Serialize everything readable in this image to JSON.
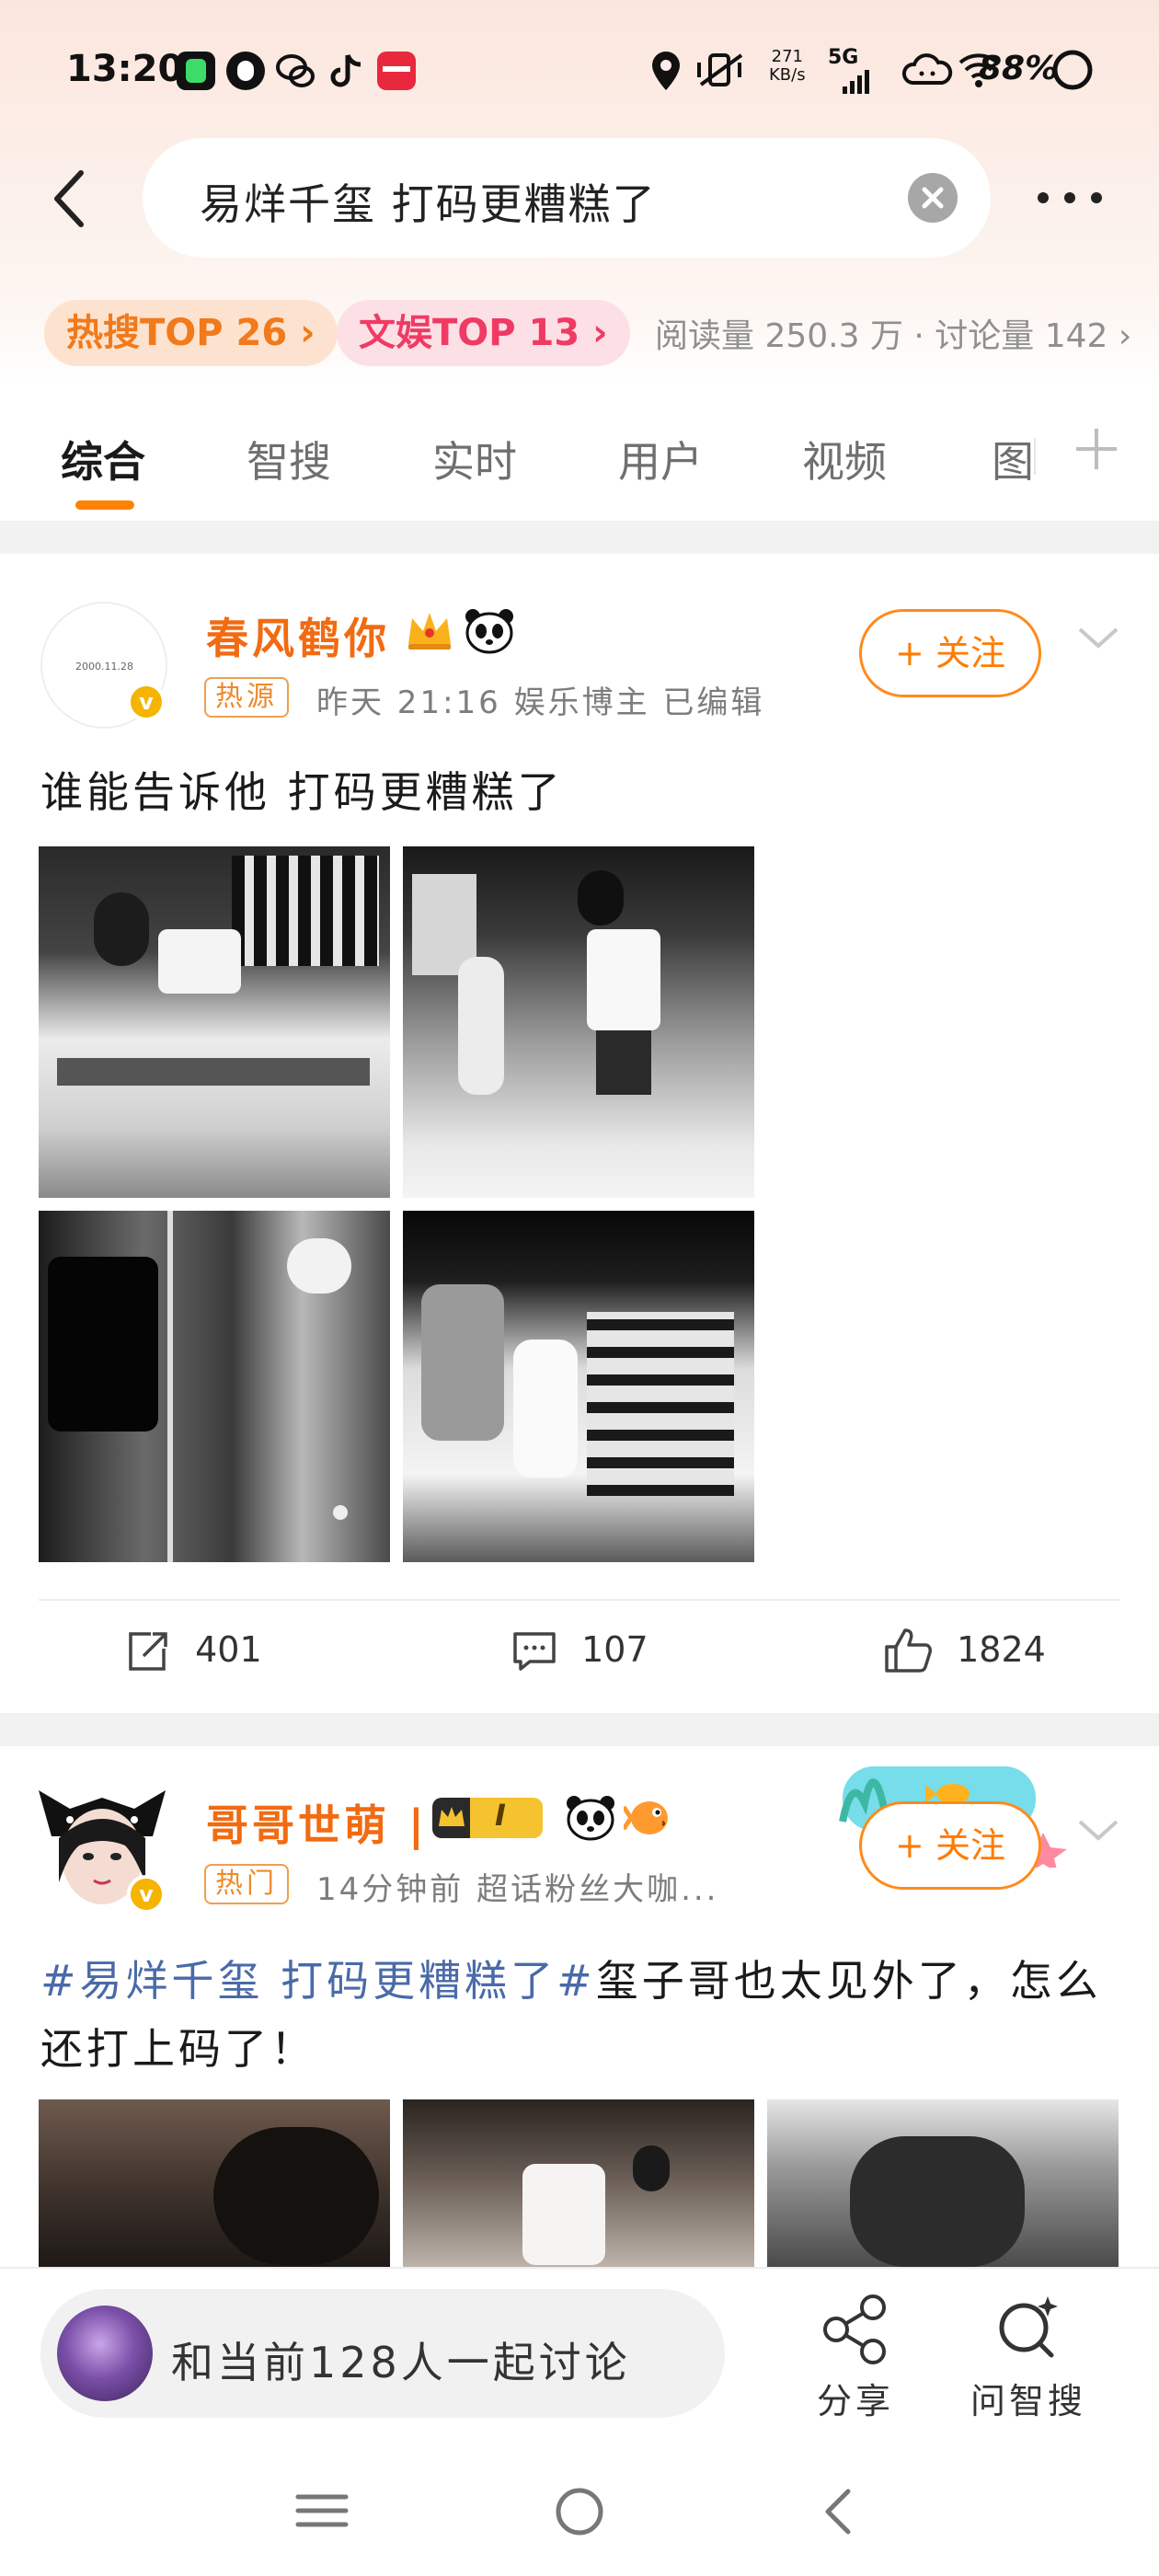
{
  "status_bar": {
    "time": "13:20",
    "network_speed": "271\nKB/s",
    "signal": "5G",
    "battery": "88%"
  },
  "search": {
    "query": "易烊千玺 打码更糟糕了"
  },
  "hot_pills": {
    "hot_search": "热搜TOP 26 ›",
    "entertainment": "文娱TOP 13 ›"
  },
  "stats": {
    "read_discuss": "阅读量 250.3 万 · 讨论量 142 ›"
  },
  "tabs": [
    "综合",
    "智搜",
    "实时",
    "用户",
    "视频",
    "图"
  ],
  "posts": [
    {
      "user": "春风鹤你",
      "avatar_text": "2000.11.28",
      "tag": "热源",
      "meta": "昨天 21:16   娱乐博主   已编辑",
      "follow": "+ 关注",
      "text": "谁能告诉他 打码更糟糕了",
      "actions": {
        "repost": "401",
        "comment": "107",
        "like": "1824"
      }
    },
    {
      "user": "哥哥世萌 |",
      "level": "I",
      "tag": "热门",
      "meta": "14分钟前   超话粉丝大咖...",
      "follow": "+ 关注",
      "topic": "#易烊千玺 打码更糟糕了#",
      "text": "玺子哥也太见外了，怎么还打上码了！"
    }
  ],
  "bottom_bar": {
    "discuss": "和当前128人一起讨论",
    "share": "分享",
    "ask": "问智搜"
  },
  "colors": {
    "accent": "#ff8200",
    "username": "#f16b12",
    "topic": "#4a6aa8"
  }
}
